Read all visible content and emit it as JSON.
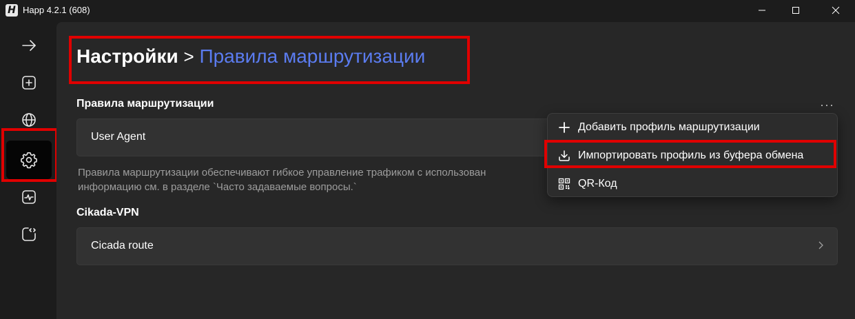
{
  "window": {
    "logo_letter": "H",
    "title": "Happ 4.2.1 (608)",
    "controls": [
      "minimize",
      "maximize",
      "close"
    ]
  },
  "sidebar": {
    "items": [
      {
        "icon": "arrow-right-icon",
        "active": false
      },
      {
        "icon": "add-square-icon",
        "active": false
      },
      {
        "icon": "globe-icon",
        "active": false
      },
      {
        "icon": "gear-icon",
        "active": true
      },
      {
        "icon": "activity-monitor-icon",
        "active": false
      },
      {
        "icon": "code-square-icon",
        "active": false
      }
    ]
  },
  "breadcrumb": {
    "root": "Настройки",
    "separator": ">",
    "current": "Правила маршрутизации"
  },
  "routing_section": {
    "title": "Правила маршрутизации",
    "card_label": "User Agent",
    "description_line1": "Правила маршрутизации обеспечивают гибкое управление трафиком с использован",
    "description_line2": "информацию см. в разделе `Часто задаваемые вопросы.`",
    "more_label": "···"
  },
  "context_menu": {
    "items": [
      {
        "label": "Добавить профиль маршрутизации",
        "icon": "plus-icon"
      },
      {
        "label": "Импортировать профиль из буфера обмена",
        "icon": "download-icon"
      },
      {
        "label": "QR-Код",
        "icon": "qr-code-icon"
      }
    ]
  },
  "cikada_section": {
    "title": "Cikada-VPN",
    "card_label": "Cicada route"
  },
  "colors": {
    "accent": "#5b7cf0",
    "highlight": "#e00000",
    "background": "#272727",
    "sidebar": "#1c1c1c"
  }
}
